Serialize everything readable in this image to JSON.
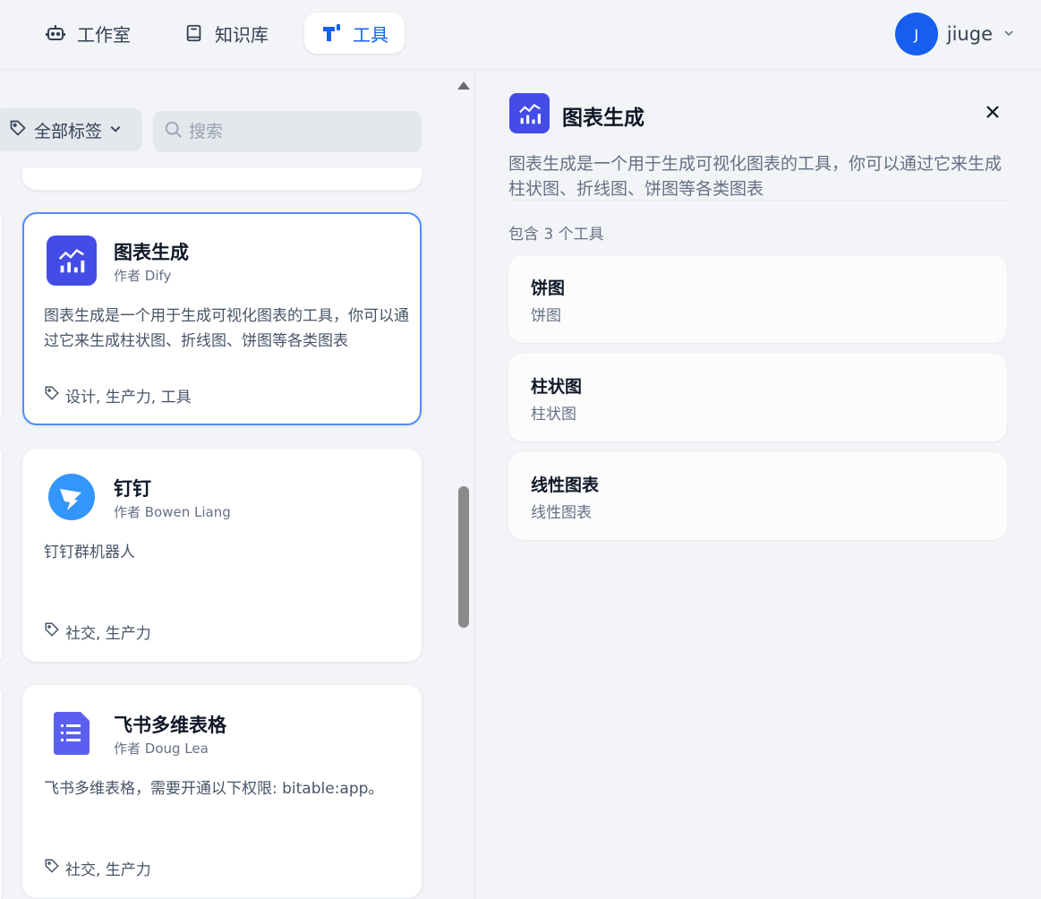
{
  "header": {
    "nav": [
      {
        "label": "工作室",
        "icon": "robot-icon"
      },
      {
        "label": "知识库",
        "icon": "book-icon"
      },
      {
        "label": "工具",
        "icon": "tool-logo-icon",
        "active": true
      }
    ],
    "user": {
      "initial": "J",
      "name": "jiuge"
    }
  },
  "filters": {
    "tag_label": "全部标签",
    "search_placeholder": "搜索"
  },
  "cards": [
    {
      "title": "图表生成",
      "author": "作者 Dify",
      "description": "图表生成是一个用于生成可视化图表的工具，你可以通过它来生成柱状图、折线图、饼图等各类图表",
      "tags": "设计, 生产力, 工具",
      "icon": "chart-icon",
      "selected": true
    },
    {
      "title": "钉钉",
      "author": "作者 Bowen Liang",
      "description": "钉钉群机器人",
      "tags": "社交, 生产力",
      "icon": "dingtalk-icon"
    },
    {
      "title": "飞书多维表格",
      "author": "作者 Doug Lea",
      "description": "飞书多维表格，需要开通以下权限: bitable:app。",
      "tags": "社交, 生产力",
      "icon": "feishu-bitable-icon"
    }
  ],
  "detail": {
    "title": "图表生成",
    "description": "图表生成是一个用于生成可视化图表的工具，你可以通过它来生成柱状图、折线图、饼图等各类图表",
    "count_label": "包含 3 个工具",
    "tools": [
      {
        "name": "饼图",
        "description": "饼图"
      },
      {
        "name": "柱状图",
        "description": "柱状图"
      },
      {
        "name": "线性图表",
        "description": "线性图表"
      }
    ]
  },
  "colors": {
    "accent": "#155eef",
    "chart_icon_bg": "#444ce7",
    "dingtalk_blue": "#3296fa",
    "feishu_purple": "#5b5ff0"
  }
}
